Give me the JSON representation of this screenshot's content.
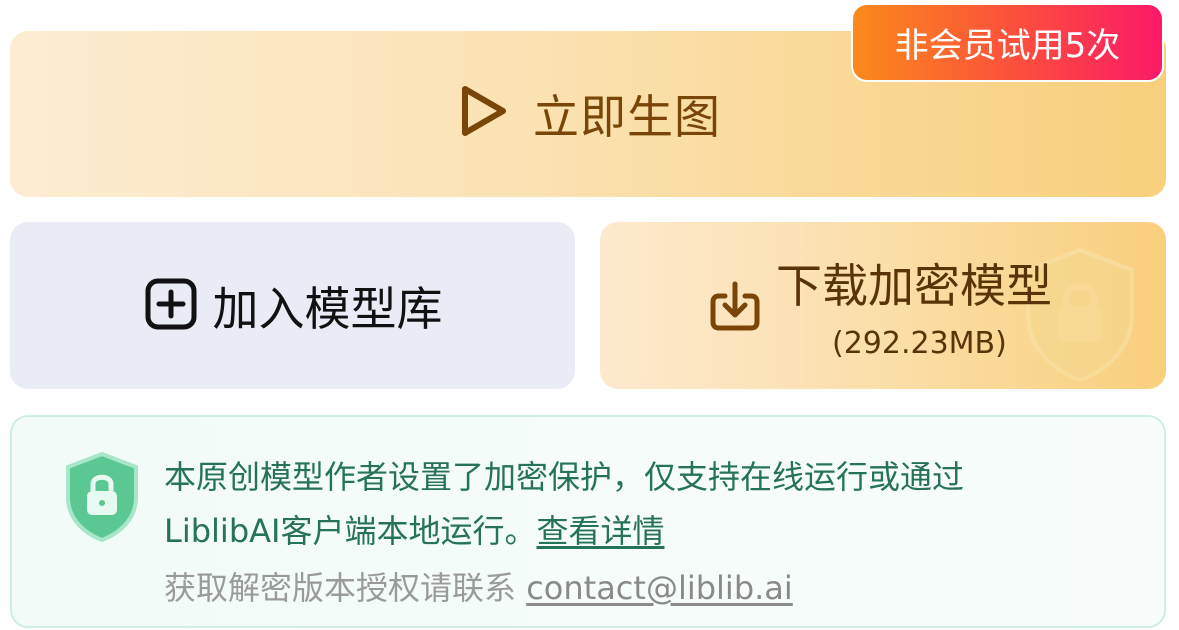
{
  "generate": {
    "label": "立即生图",
    "badge": "非会员试用5次"
  },
  "add_library": {
    "label": "加入模型库"
  },
  "download": {
    "label": "下载加密模型",
    "size": "(292.23MB)"
  },
  "notice": {
    "line1": "本原创模型作者设置了加密保护，仅支持在线运行或通过",
    "line2_prefix": "LiblibAI客户端本地运行。",
    "details_link": "查看详情",
    "line3_prefix": "获取解密版本授权请联系 ",
    "email": "contact@liblib.ai"
  },
  "colors": {
    "generate_text": "#7a4508",
    "badge_start": "#fb8a1b",
    "badge_end": "#fb1967",
    "notice_text": "#26735a",
    "notice_muted": "#9a9a9a",
    "shield_green": "#5bc792"
  },
  "icons": {
    "generate": "play-icon",
    "add": "plus-square-icon",
    "download": "download-icon",
    "lock_watermark": "shield-lock-icon",
    "notice": "shield-lock-icon"
  }
}
